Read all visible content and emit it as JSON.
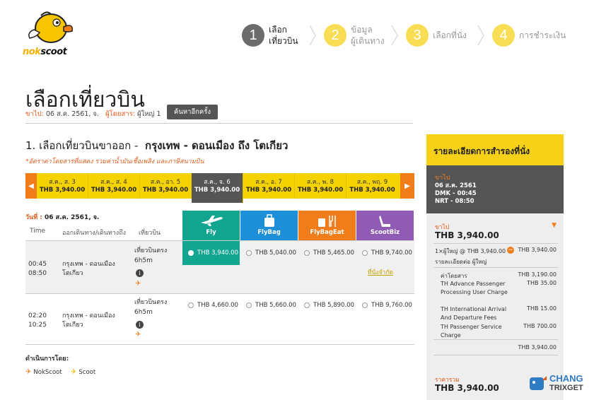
{
  "brand": {
    "name_prefix": "nok",
    "name_suffix": "scoot"
  },
  "steps": [
    {
      "num": "1",
      "line1": "เลือก",
      "line2": "เที่ยวบิน",
      "active": true
    },
    {
      "num": "2",
      "line1": "ข้อมูล",
      "line2": "ผู้เดินทาง",
      "active": false
    },
    {
      "num": "3",
      "line1": "เลือกที่นั่ง",
      "line2": "",
      "active": false
    },
    {
      "num": "4",
      "line1": "การชำระเงิน",
      "line2": "",
      "active": false
    }
  ],
  "page": {
    "title": "เลือกเที่ยวบิน",
    "depart_label": "ขาไป:",
    "depart_value": "06 ส.ค. 2561, จ.",
    "pax_label": "ผู้โดยสาร:",
    "pax_value": "ผู้ใหญ่ 1",
    "search_again": "ค้นหาอีกครั้ง"
  },
  "outbound": {
    "title_prefix": "1. เลือกเที่ยวบินขาออก -",
    "route": "กรุงเทพ - ดอนเมือง  ถึง  โตเกียว",
    "note": "*อัตราค่าโดยสารที่แสดง รวมค่าน้ำมันเชื้อเพลิง และภาษีสนามบิน",
    "dates": [
      {
        "day": "ส.ค., ส. 3",
        "price": "THB 3,940.00",
        "selected": false
      },
      {
        "day": "ส.ค., ส. 4",
        "price": "THB 3,940.00",
        "selected": false
      },
      {
        "day": "ส.ค., อา. 5",
        "price": "THB 3,940.00",
        "selected": false
      },
      {
        "day": "ส.ค., จ. 6",
        "price": "THB 3,940.00",
        "selected": true
      },
      {
        "day": "ส.ค., อ. 7",
        "price": "THB 3,940.00",
        "selected": false
      },
      {
        "day": "ส.ค., พ. 8",
        "price": "THB 3,940.00",
        "selected": false
      },
      {
        "day": "ส.ค., พฤ. 9",
        "price": "THB 3,940.00",
        "selected": false
      }
    ],
    "day_label": "วันที่ :",
    "day_value": "06 ส.ค. 2561, จ.",
    "columns": {
      "time": "Time",
      "route": "ออกเดินทาง/เดินทางถึง",
      "flight": "เที่ยวบิน"
    },
    "fares": [
      {
        "name": "Fly",
        "color": "#12a590",
        "icon": "plane-icon"
      },
      {
        "name": "FlyBag",
        "color": "#1d8fd8",
        "icon": "bag-icon"
      },
      {
        "name": "FlyBagEat",
        "color": "#f07c1a",
        "icon": "meal-icon"
      },
      {
        "name": "ScootBiz",
        "color": "#8f5bb5",
        "icon": "seat-icon"
      }
    ],
    "flights": [
      {
        "depart": "00:45",
        "arrive": "08:50",
        "from": "กรุงเทพ - ดอนเมือง",
        "to": "โตเกียว",
        "type": "เที่ยวบินตรง",
        "duration": "6h5m",
        "prices": [
          "THB 3,940.00",
          "THB 5,040.00",
          "THB 5,465.00",
          "THB 9,740.00"
        ],
        "seats_left": "ที่นั่งจำกัด"
      },
      {
        "depart": "02:20",
        "arrive": "10:25",
        "from": "กรุงเทพ - ดอนเมือง",
        "to": "โตเกียว",
        "type": "เที่ยวบินตรง",
        "duration": "6h5m",
        "prices": [
          "THB 4,660.00",
          "THB 5,660.00",
          "THB 5,890.00",
          "THB 9,760.00"
        ],
        "seats_left": ""
      }
    ],
    "operated_by": "ดำเนินการโดย:",
    "operators": [
      "NokScoot",
      "Scoot"
    ]
  },
  "summary": {
    "title": "รายละเอียดการสำรองที่นั่ง",
    "leg_label": "ขาไป",
    "leg_date": "06 ส.ค. 2561",
    "leg_dep": "DMK - 00:45",
    "leg_arr": "NRT - 08:50",
    "fare_label": "ขาไป",
    "fare_total": "THB 3,940.00",
    "pax_line": "1×ผู้ใหญ่ @ THB 3,940.00",
    "pax_total": "THB 3,940.00",
    "pax_detail": "รายละเอียดต่อ ผู้ใหญ่",
    "items": [
      {
        "name": "ค่าโดยสาร",
        "amount": "THB 3,190.00"
      },
      {
        "name": "TH Advance Passenger Processing User Charge",
        "amount": "THB 35.00"
      },
      {
        "name": "TH International Arrival And Departure Fees",
        "amount": "THB 15.00"
      },
      {
        "name": "TH Passenger Service Charge",
        "amount": "THB 700.00"
      }
    ],
    "subtotal": "THB 3,940.00",
    "grand_label": "ราคารวม",
    "grand_total": "THB 3,940.00"
  },
  "watermark": {
    "line1": "CHANG",
    "line2": "TRIXGET"
  },
  "colors": {
    "brand_yellow": "#f7d117",
    "accent_orange": "#f07c1a",
    "selected_green": "#12a590"
  }
}
